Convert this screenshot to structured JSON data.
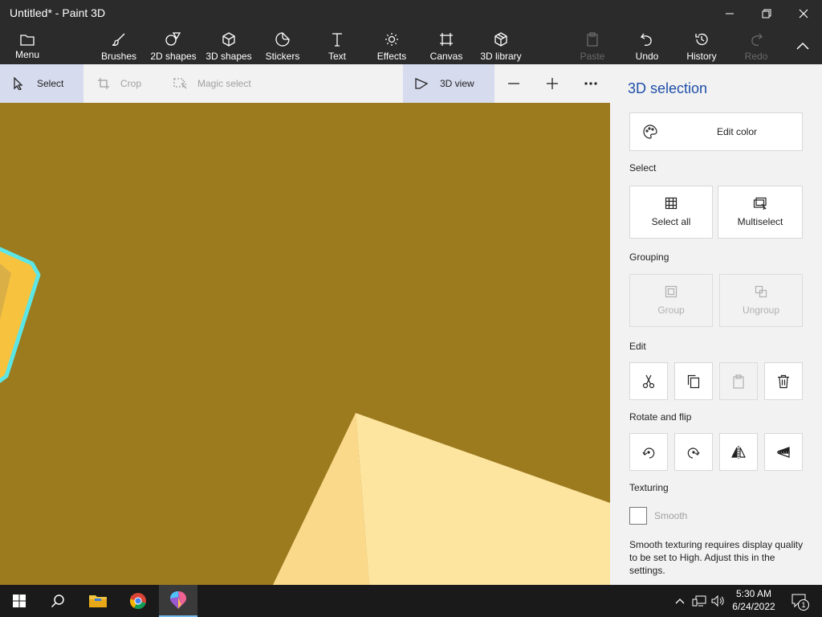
{
  "window": {
    "title": "Untitled* - Paint 3D"
  },
  "ribbon": {
    "menu": "Menu",
    "brushes": "Brushes",
    "shapes2d": "2D shapes",
    "shapes3d": "3D shapes",
    "stickers": "Stickers",
    "text": "Text",
    "effects": "Effects",
    "canvas": "Canvas",
    "library3d": "3D library",
    "paste": "Paste",
    "undo": "Undo",
    "history": "History",
    "redo": "Redo"
  },
  "toolbar": {
    "select": "Select",
    "crop": "Crop",
    "magic_select": "Magic select",
    "view3d": "3D view"
  },
  "panel": {
    "title": "3D selection",
    "edit_color": "Edit color",
    "select_label": "Select",
    "select_all": "Select all",
    "multiselect": "Multiselect",
    "grouping_label": "Grouping",
    "group": "Group",
    "ungroup": "Ungroup",
    "edit_label": "Edit",
    "rotate_label": "Rotate and flip",
    "texturing_label": "Texturing",
    "smooth": "Smooth",
    "smooth_checked": false,
    "note": "Smooth texturing requires display quality to be set to High. Adjust this in the settings."
  },
  "taskbar": {
    "time": "5:30 AM",
    "date": "6/24/2022",
    "notification_count": "1"
  },
  "colors": {
    "canvas": "#9c7a1e",
    "accent": "#1f4fa8",
    "selection_outline": "#5ce6e6"
  }
}
